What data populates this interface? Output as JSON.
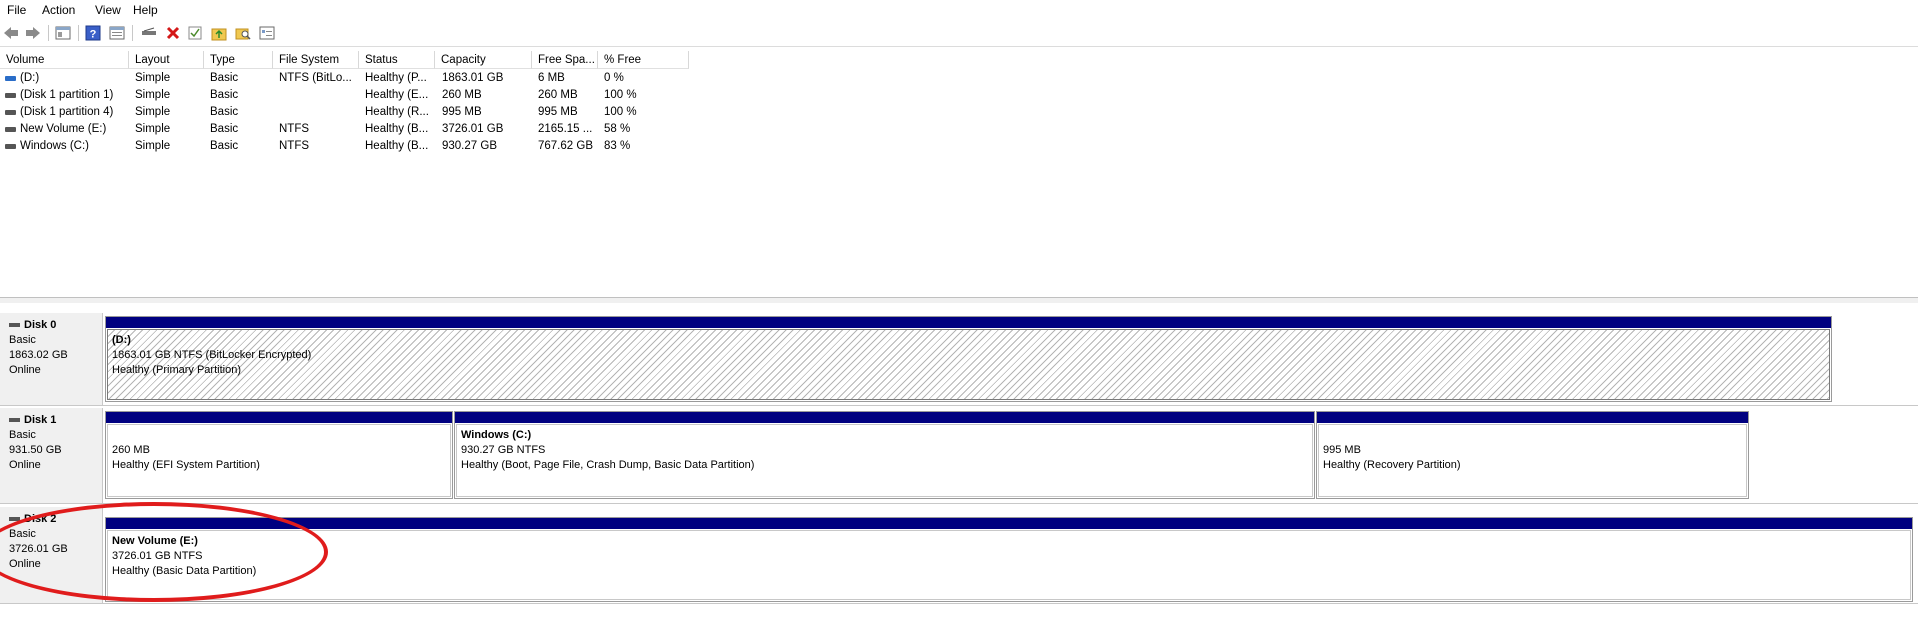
{
  "menu": [
    "File",
    "Action",
    "View",
    "Help"
  ],
  "toolbar": {
    "buttons": [
      "back-arrow-icon",
      "forward-arrow-icon",
      "console-tree-icon",
      "help-icon",
      "properties-icon",
      "connect-drive-icon",
      "delete-icon",
      "check-icon",
      "folder-up-icon",
      "search-folder-icon",
      "details-icon"
    ]
  },
  "volume_list": {
    "columns": [
      "Volume",
      "Layout",
      "Type",
      "File System",
      "Status",
      "Capacity",
      "Free Spa...",
      "% Free"
    ],
    "rows": [
      [
        "(D:)",
        "Simple",
        "Basic",
        "NTFS (BitLo...",
        "Healthy (P...",
        "1863.01 GB",
        "6 MB",
        "0 %"
      ],
      [
        "(Disk 1 partition 1)",
        "Simple",
        "Basic",
        "",
        "Healthy (E...",
        "260 MB",
        "260 MB",
        "100 %"
      ],
      [
        "(Disk 1 partition 4)",
        "Simple",
        "Basic",
        "",
        "Healthy (R...",
        "995 MB",
        "995 MB",
        "100 %"
      ],
      [
        "New Volume (E:)",
        "Simple",
        "Basic",
        "NTFS",
        "Healthy (B...",
        "3726.01 GB",
        "2165.15 ...",
        "58 %"
      ],
      [
        "Windows (C:)",
        "Simple",
        "Basic",
        "NTFS",
        "Healthy (B...",
        "930.27 GB",
        "767.62 GB",
        "83 %"
      ]
    ]
  },
  "disks": [
    {
      "name": "Disk 0",
      "type": "Basic",
      "size": "1863.02 GB",
      "state": "Online",
      "partitions": [
        {
          "name": "(D:)",
          "size": "1863.01 GB NTFS (BitLocker Encrypted)",
          "status": "Healthy (Primary Partition)"
        }
      ]
    },
    {
      "name": "Disk 1",
      "type": "Basic",
      "size": "931.50 GB",
      "state": "Online",
      "partitions": [
        {
          "name": "",
          "size": "260 MB",
          "status": "Healthy (EFI System Partition)"
        },
        {
          "name": "Windows  (C:)",
          "size": "930.27 GB NTFS",
          "status": "Healthy (Boot, Page File, Crash Dump, Basic Data Partition)"
        },
        {
          "name": "",
          "size": "995 MB",
          "status": "Healthy (Recovery Partition)"
        }
      ]
    },
    {
      "name": "Disk 2",
      "type": "Basic",
      "size": "3726.01 GB",
      "state": "Online",
      "partitions": [
        {
          "name": "New Volume  (E:)",
          "size": "3726.01 GB NTFS",
          "status": "Healthy (Basic Data Partition)"
        }
      ]
    }
  ],
  "colors": {
    "partition_bar": "#000080",
    "annotation": "#e01c1c"
  }
}
